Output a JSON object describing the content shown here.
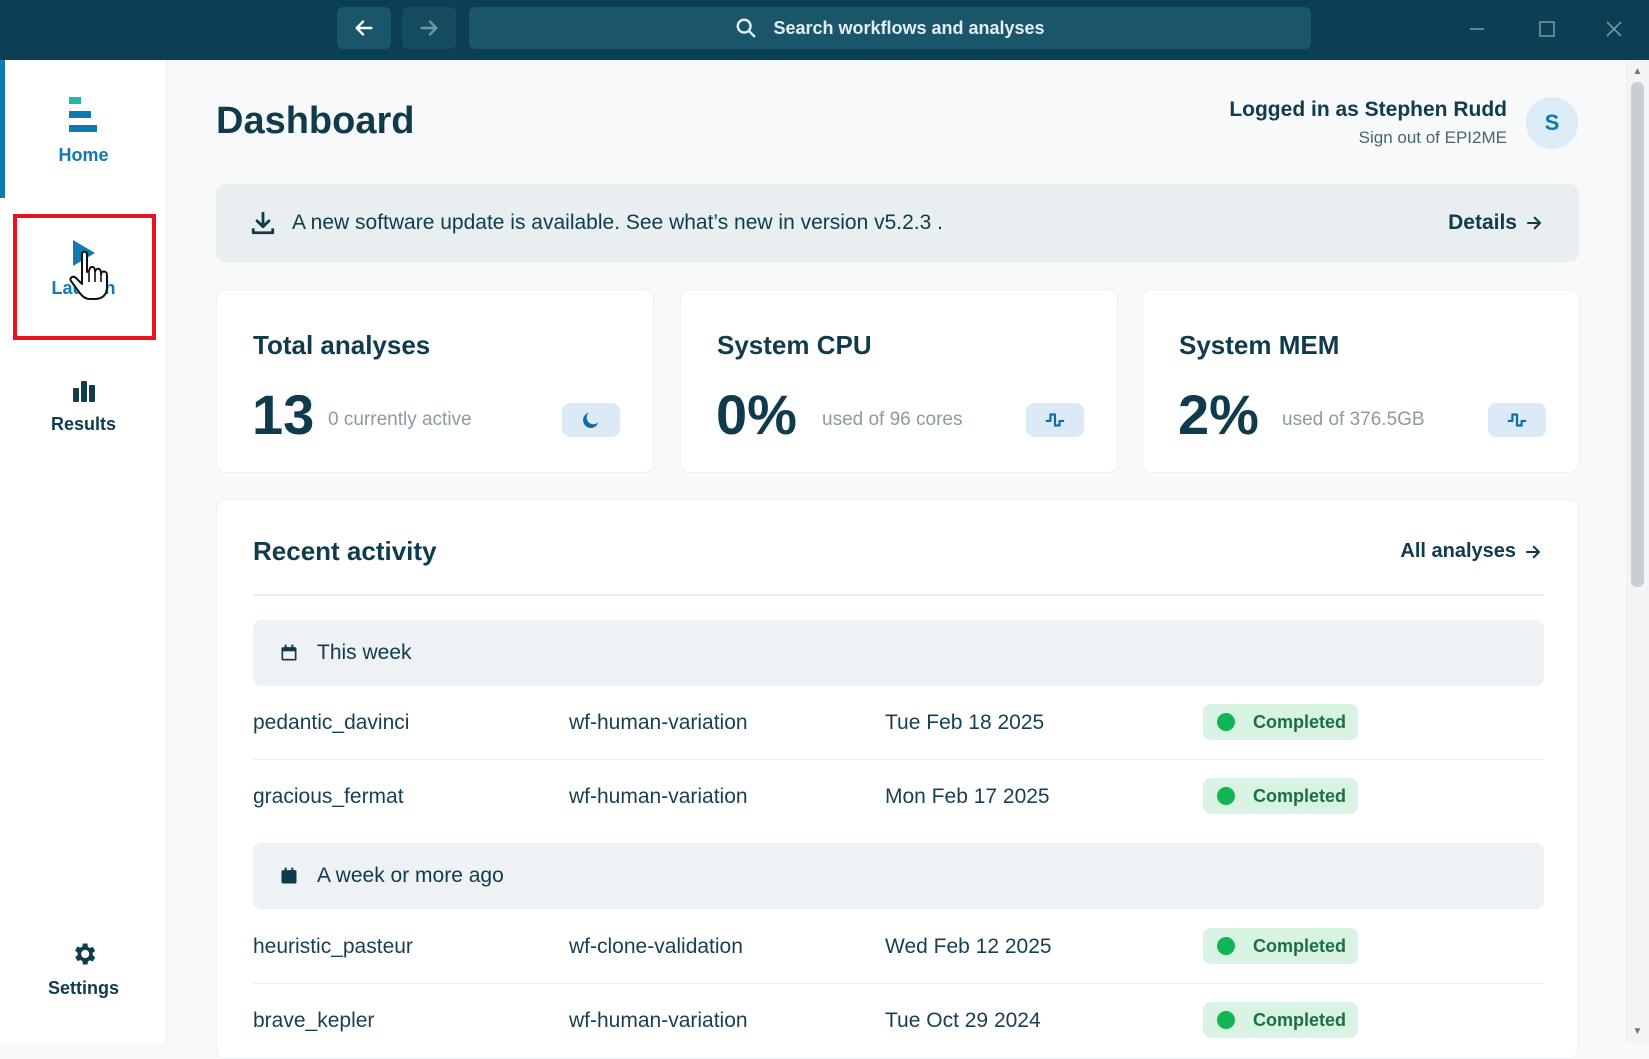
{
  "titlebar": {
    "search_placeholder": "Search workflows and analyses"
  },
  "sidebar": {
    "items": [
      {
        "label": "Home",
        "icon": "home-logo-icon",
        "active": true
      },
      {
        "label": "Launch",
        "icon": "play-icon",
        "active": false
      },
      {
        "label": "Results",
        "icon": "bar-chart-icon",
        "active": false
      },
      {
        "label": "Settings",
        "icon": "gear-icon",
        "active": false
      }
    ]
  },
  "header": {
    "title": "Dashboard",
    "user_text": "Logged in as Stephen Rudd",
    "sign_out": "Sign out of EPI2ME",
    "avatar_letter": "S"
  },
  "banner": {
    "message": "A new software update is available. See what’s new in version v5.2.3 .",
    "details_label": "Details"
  },
  "stats": [
    {
      "title": "Total analyses",
      "value": "13",
      "sub": "0 currently active",
      "icon": "moon-icon"
    },
    {
      "title": "System CPU",
      "value": "0%",
      "sub": "used of 96 cores",
      "icon": "pulse-icon"
    },
    {
      "title": "System MEM",
      "value": "2%",
      "sub": "used of 376.5GB",
      "icon": "pulse-icon"
    }
  ],
  "activity": {
    "title": "Recent activity",
    "all_link": "All analyses",
    "groups": [
      {
        "label": "This week",
        "rows": [
          {
            "name": "pedantic_davinci",
            "workflow": "wf-human-variation",
            "date": "Tue Feb 18 2025",
            "status": "Completed"
          },
          {
            "name": "gracious_fermat",
            "workflow": "wf-human-variation",
            "date": "Mon Feb 17 2025",
            "status": "Completed"
          }
        ]
      },
      {
        "label": "A week or more ago",
        "rows": [
          {
            "name": "heuristic_pasteur",
            "workflow": "wf-clone-validation",
            "date": "Wed Feb 12 2025",
            "status": "Completed"
          },
          {
            "name": "brave_kepler",
            "workflow": "wf-human-variation",
            "date": "Tue Oct 29 2024",
            "status": "Completed"
          }
        ]
      }
    ]
  },
  "colors": {
    "titlebar": "#0c3f54",
    "accent": "#0f7ab1",
    "completed": "#13b454",
    "highlight": "#e8141b"
  }
}
